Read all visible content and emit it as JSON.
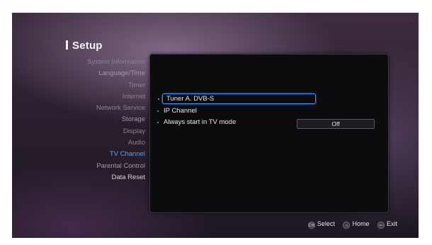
{
  "setup": {
    "title": "Setup"
  },
  "menu": {
    "items": [
      {
        "label": "System Information"
      },
      {
        "label": "Language/Time"
      },
      {
        "label": "Timer"
      },
      {
        "label": "Internet"
      },
      {
        "label": "Network Service"
      },
      {
        "label": "Storage"
      },
      {
        "label": "Display"
      },
      {
        "label": "Audio"
      },
      {
        "label": "TV Channel"
      },
      {
        "label": "Parental Control"
      },
      {
        "label": "Data Reset"
      }
    ],
    "active": "TV Channel"
  },
  "panel": {
    "options": [
      {
        "label": "Tuner A. DVB-S"
      },
      {
        "label": "IP Channel"
      },
      {
        "label": "Always start in TV mode",
        "value": "Off"
      }
    ]
  },
  "hints": {
    "select": "Select",
    "home": "Home",
    "exit": "Exit"
  },
  "colors": {
    "accent": "#4da3ff",
    "focus_border": "#3a9bff"
  },
  "icons": {
    "select": "ok-button-icon",
    "home": "home-button-icon",
    "exit": "back-button-icon"
  }
}
